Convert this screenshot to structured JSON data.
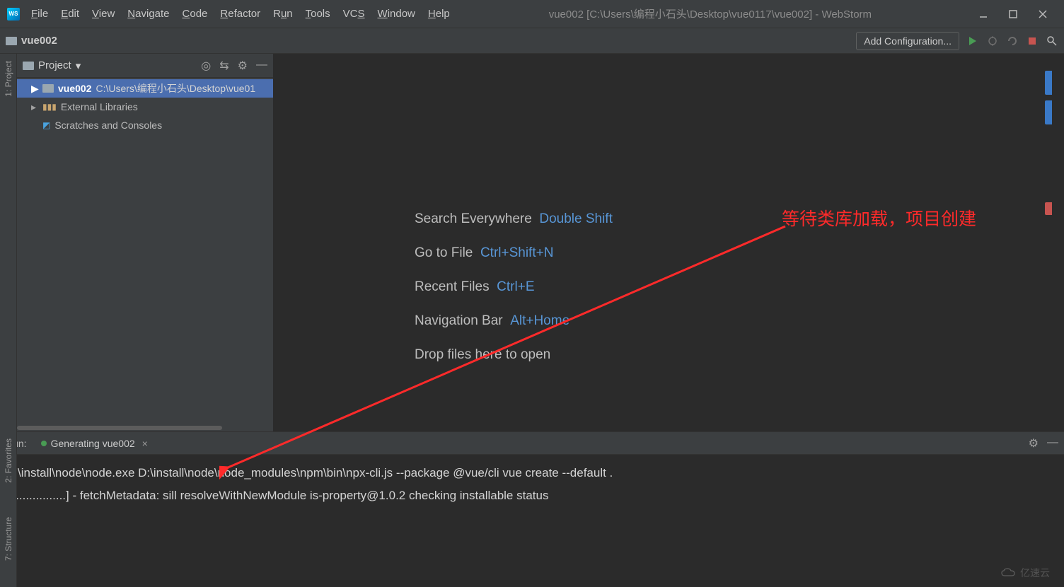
{
  "window_title": "vue002 [C:\\Users\\编程小石头\\Desktop\\vue0117\\vue002] - WebStorm",
  "app_icon_text": "WS",
  "menus": [
    "File",
    "Edit",
    "View",
    "Navigate",
    "Code",
    "Refactor",
    "Run",
    "Tools",
    "VCS",
    "Window",
    "Help"
  ],
  "breadcrumb": "vue002",
  "add_config": "Add Configuration...",
  "project": {
    "label": "Project",
    "root_name": "vue002",
    "root_path": "C:\\Users\\编程小石头\\Desktop\\vue01",
    "external_libs": "External Libraries",
    "scratches": "Scratches and Consoles"
  },
  "welcome": {
    "search": "Search Everywhere",
    "search_kbd": "Double Shift",
    "goto": "Go to File",
    "goto_kbd": "Ctrl+Shift+N",
    "recent": "Recent Files",
    "recent_kbd": "Ctrl+E",
    "nav": "Navigation Bar",
    "nav_kbd": "Alt+Home",
    "drop": "Drop files here to open"
  },
  "run": {
    "label": "Run:",
    "tab": "Generating vue002",
    "line1": "D:\\install\\node\\node.exe D:\\install\\node\\node_modules\\npm\\bin\\npx-cli.js --package @vue/cli vue create --default .",
    "line2": "[.................] - fetchMetadata: sill resolveWithNewModule is-property@1.0.2 checking installable status"
  },
  "annotation": "等待类库加载，项目创建",
  "watermark": "亿速云",
  "side": {
    "proj": "1: Project",
    "fav": "2: Favorites",
    "struct": "7: Structure"
  }
}
